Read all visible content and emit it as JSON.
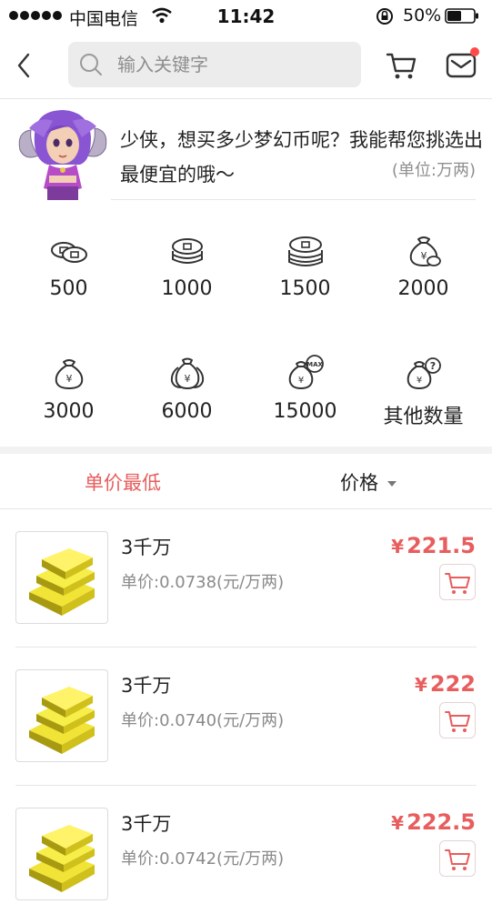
{
  "status_bar": {
    "carrier": "中国电信",
    "time": "11:42",
    "battery": "50%"
  },
  "search": {
    "placeholder": "输入关键字",
    "value": ""
  },
  "promo": {
    "text": "少侠，想买多少梦幻币呢？我能帮您挑选出最便宜的哦～",
    "unit": "(单位:万两)"
  },
  "amounts": [
    {
      "label": "500",
      "icon": "coins-small-icon"
    },
    {
      "label": "1000",
      "icon": "coins-stack-icon"
    },
    {
      "label": "1500",
      "icon": "coins-pile-icon"
    },
    {
      "label": "2000",
      "icon": "money-bag-icon"
    },
    {
      "label": "3000",
      "icon": "money-bag-icon"
    },
    {
      "label": "6000",
      "icon": "money-bags-icon"
    },
    {
      "label": "15000",
      "icon": "money-bag-max-icon"
    },
    {
      "label": "其他数量",
      "icon": "money-bag-question-icon"
    }
  ],
  "sort": {
    "tabs": [
      "单价最低",
      "价格"
    ],
    "active": 0,
    "accent": "#e85d5d"
  },
  "products": [
    {
      "title": "3千万",
      "unit_price": "单价:0.0738(元/万两)",
      "currency": "¥",
      "price_int": "221",
      "price_dec": ".5"
    },
    {
      "title": "3千万",
      "unit_price": "单价:0.0740(元/万两)",
      "currency": "¥",
      "price_int": "222",
      "price_dec": ""
    },
    {
      "title": "3千万",
      "unit_price": "单价:0.0742(元/万两)",
      "currency": "¥",
      "price_int": "222",
      "price_dec": ".5"
    }
  ]
}
